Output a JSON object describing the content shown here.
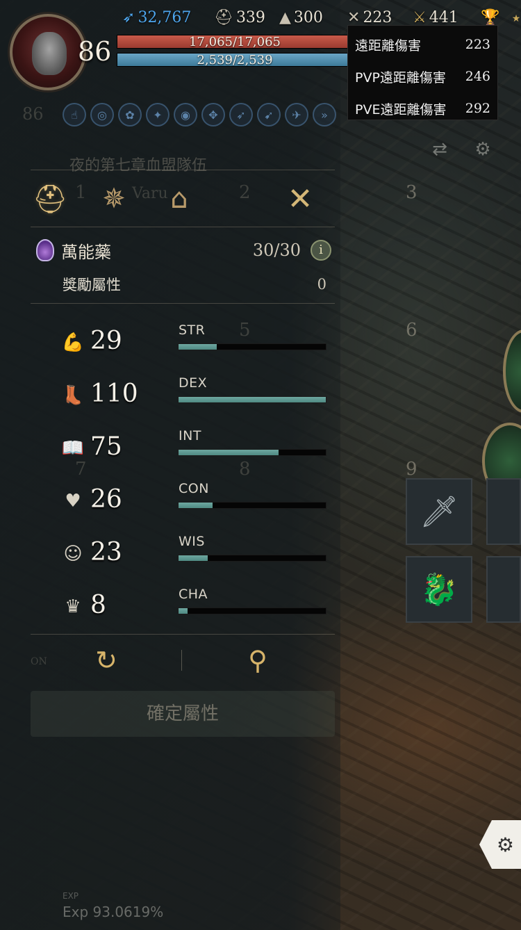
{
  "hud": {
    "level": "86",
    "power": "32,767",
    "stat_helmet": "339",
    "stat_hat": "300",
    "stat_bow": "223",
    "stat_gear": "441",
    "hp_text": "17,065/17,065",
    "mp_text": "2,539/2,539",
    "icons": {
      "power": "quill-icon",
      "helmet": "helmet-icon",
      "hat": "wizard-hat-icon",
      "bow": "crossed-arrows-icon",
      "gear": "crossed-swords-icon",
      "trophy": "trophy-icon"
    },
    "colors": {
      "hp": "#b44a3d",
      "mp": "#4f8fb0",
      "power": "#4ea6ee"
    }
  },
  "tooltip": {
    "rows": [
      {
        "label": "遠距離傷害",
        "value": "223"
      },
      {
        "label": "PVP遠距離傷害",
        "value": "246"
      },
      {
        "label": "PVE遠距離傷害",
        "value": "292"
      }
    ]
  },
  "background": {
    "level_badge": "86",
    "party_title": "夜的第七章血盟隊伍",
    "party_member": "Varu",
    "slot_numbers": [
      "1",
      "2",
      "3",
      "5",
      "6",
      "7",
      "8",
      "9"
    ],
    "auto_label": "ON",
    "exp_label": "EXP",
    "exp_text": "Exp 93.0619%"
  },
  "panel": {
    "tabs": [
      {
        "name": "armor",
        "icon": "helmet-icon"
      },
      {
        "name": "class",
        "icon": "star-compass-icon"
      },
      {
        "name": "housing",
        "icon": "house-icon"
      }
    ],
    "close_icon": "close-icon",
    "potion": {
      "label": "萬能藥",
      "count": "30/30",
      "info": "i"
    },
    "bonus": {
      "label": "獎勵屬性",
      "value": "0"
    },
    "stats": [
      {
        "abbr": "STR",
        "value": "29",
        "fill": 0.26,
        "icon": "muscle-arm-icon"
      },
      {
        "abbr": "DEX",
        "value": "110",
        "fill": 1.0,
        "icon": "boot-icon"
      },
      {
        "abbr": "INT",
        "value": "75",
        "fill": 0.68,
        "icon": "book-icon"
      },
      {
        "abbr": "CON",
        "value": "26",
        "fill": 0.23,
        "icon": "heart-pulse-icon"
      },
      {
        "abbr": "WIS",
        "value": "23",
        "fill": 0.2,
        "icon": "head-mind-icon"
      },
      {
        "abbr": "CHA",
        "value": "8",
        "fill": 0.06,
        "icon": "crown-icon"
      }
    ],
    "reset_icon": "reset-icon",
    "search_icon": "search-icon",
    "confirm_label": "確定屬性"
  },
  "colors": {
    "accent_gold": "#d7b46a",
    "bar_fill": "#5f9a93"
  }
}
